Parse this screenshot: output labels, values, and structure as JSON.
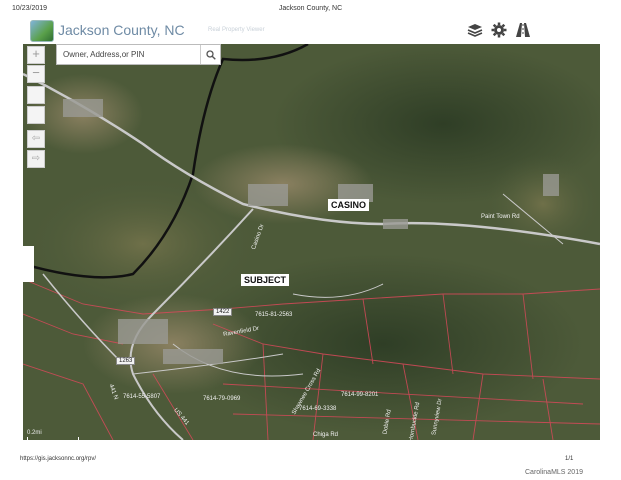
{
  "print": {
    "date": "10/23/2019",
    "title": "Jackson County, NC"
  },
  "app": {
    "title": "Jackson County, NC",
    "subtitle": "Real Property Viewer"
  },
  "tools": {
    "layers_icon": "layers-icon",
    "settings_icon": "gear-icon",
    "measure_icon": "road-icon"
  },
  "zoom": {
    "in_label": "+",
    "out_label": "−"
  },
  "nav": {
    "back_label": "⇦",
    "forward_label": "⇨"
  },
  "search": {
    "placeholder": "Owner, Address,or PIN",
    "value": ""
  },
  "callouts": {
    "casino": "CASINO",
    "subject": "SUBJECT"
  },
  "map_labels": {
    "paint_town_rd": "Paint Town Rd",
    "casino_dr": "Casino Dr",
    "ravenfield_dr": "Ravenfield Dr",
    "shawnee_rd": "Shawnee Cross Rd",
    "chiga_rd": "Chiga Rd",
    "parcel_1": "7615-81-2563",
    "parcel_2": "7614-79-0969",
    "parcel_3": "7614-69-3338",
    "parcel_4": "7614-99-8201",
    "parcel_5": "7614-55-5807",
    "route_1": "1422",
    "route_2": "1263",
    "hwy_441": "441 N",
    "dobie_rd": "Dobie Rd",
    "hornbuckle": "Hornbuckle Rd",
    "sunnyview": "Sunnyview Dr",
    "us441": "US 441",
    "scale": "0.2mi"
  },
  "footer": {
    "url": "https://gis.jacksonnc.org/rpv/",
    "page": "1/1"
  },
  "watermark": "CarolinaMLS 2019",
  "colors": {
    "terrain": "#4d5a39",
    "roads": "#c9c9c9",
    "parcel_lines": "#d8495a",
    "boundary": "#111111"
  }
}
